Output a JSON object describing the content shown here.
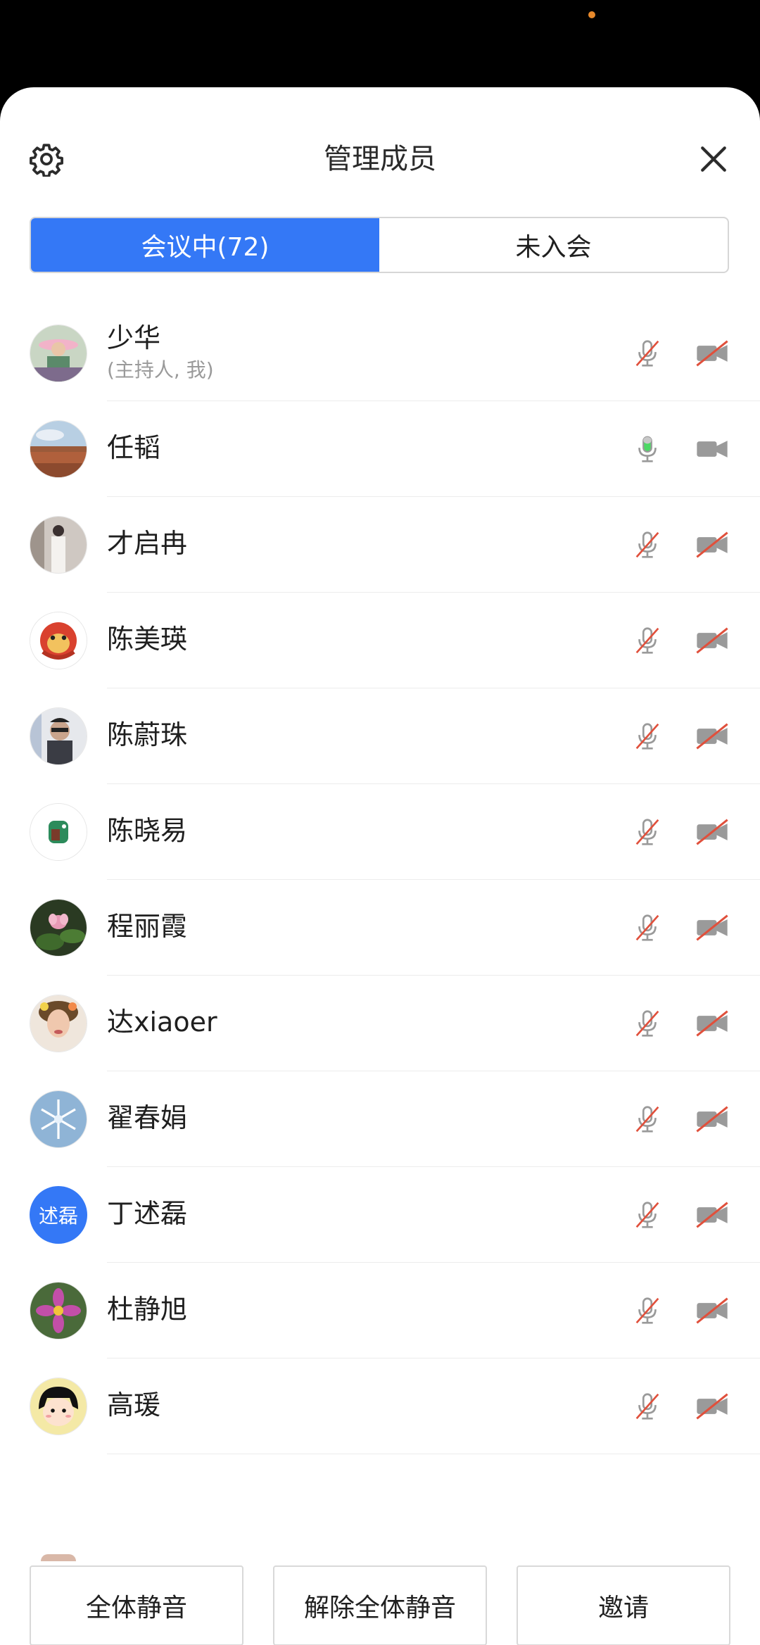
{
  "header": {
    "title": "管理成员"
  },
  "tabs": [
    {
      "label": "会议中(72)",
      "active": true
    },
    {
      "label": "未入会",
      "active": false
    }
  ],
  "members": [
    {
      "name": "少华",
      "sub": "(主持人, 我)",
      "mic": "muted",
      "cam": "off",
      "avatar": "sunhat-woman"
    },
    {
      "name": "任韬",
      "sub": "",
      "mic": "active",
      "cam": "on",
      "avatar": "desert-mesa"
    },
    {
      "name": "才启冉",
      "sub": "",
      "mic": "muted",
      "cam": "off",
      "avatar": "person-white-outfit"
    },
    {
      "name": "陈美瑛",
      "sub": "",
      "mic": "muted",
      "cam": "off",
      "avatar": "cartoon-bird"
    },
    {
      "name": "陈蔚珠",
      "sub": "",
      "mic": "muted",
      "cam": "off",
      "avatar": "man-sunglasses"
    },
    {
      "name": "陈晓易",
      "sub": "",
      "mic": "muted",
      "cam": "off",
      "avatar": "cartoon-character"
    },
    {
      "name": "程丽霞",
      "sub": "",
      "mic": "muted",
      "cam": "off",
      "avatar": "lotus-flower"
    },
    {
      "name": "达xiaoer",
      "sub": "",
      "mic": "muted",
      "cam": "off",
      "avatar": "woman-portrait"
    },
    {
      "name": "翟春娟",
      "sub": "",
      "mic": "muted",
      "cam": "off",
      "avatar": "snowflake"
    },
    {
      "name": "丁述磊",
      "sub": "",
      "mic": "muted",
      "cam": "off",
      "avatar": "text",
      "avatar_text": "述磊"
    },
    {
      "name": "杜静旭",
      "sub": "",
      "mic": "muted",
      "cam": "off",
      "avatar": "cosmos-flower"
    },
    {
      "name": "高瑗",
      "sub": "",
      "mic": "muted",
      "cam": "off",
      "avatar": "cartoon-girl"
    }
  ],
  "footer": {
    "mute_all": "全体静音",
    "unmute_all": "解除全体静音",
    "invite": "邀请"
  },
  "colors": {
    "accent": "#3478f6",
    "mic_active": "#4cd964",
    "muted_slash": "#e0503c",
    "icon_gray": "#9a9a9a"
  }
}
